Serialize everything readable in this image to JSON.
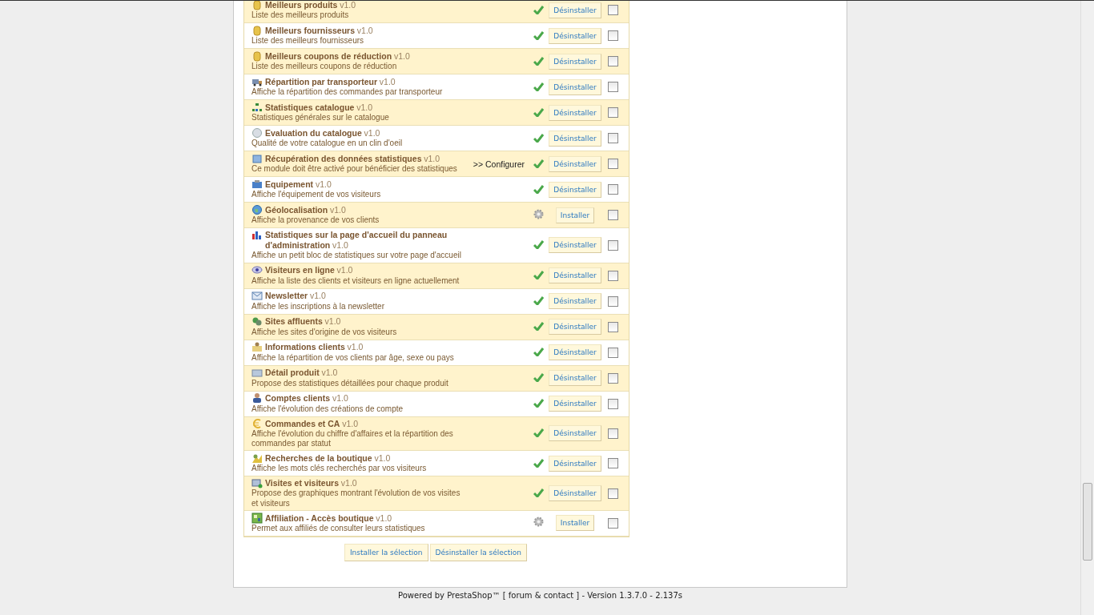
{
  "modules": [
    {
      "name": "Meilleurs produits",
      "version": "v1.0",
      "description": "Liste des meilleurs produits",
      "installed": true,
      "action": "Désinstaller",
      "checked": false
    },
    {
      "name": "Meilleurs fournisseurs",
      "version": "v1.0",
      "description": "Liste des meilleurs fournisseurs",
      "installed": true,
      "action": "Désinstaller",
      "checked": false
    },
    {
      "name": "Meilleurs coupons de réduction",
      "version": "v1.0",
      "description": "Liste des meilleurs coupons de réduction",
      "installed": true,
      "action": "Désinstaller",
      "checked": false
    },
    {
      "name": "Répartition par transporteur",
      "version": "v1.0",
      "description": "Affiche la répartition des commandes par transporteur",
      "installed": true,
      "action": "Désinstaller",
      "checked": false
    },
    {
      "name": "Statistiques catalogue",
      "version": "v1.0",
      "description": "Statistiques générales sur le catalogue",
      "installed": true,
      "action": "Désinstaller",
      "checked": false
    },
    {
      "name": "Evaluation du catalogue",
      "version": "v1.0",
      "description": "Qualité de votre catalogue en un clin d'oeil",
      "installed": true,
      "action": "Désinstaller",
      "checked": false
    },
    {
      "name": "Récupération des données statistiques",
      "version": "v1.0",
      "description": "Ce module doit être activé pour bénéficier des statistiques",
      "configure": ">> Configurer",
      "installed": true,
      "action": "Désinstaller",
      "checked": false
    },
    {
      "name": "Equipement",
      "version": "v1.0",
      "description": "Affiche l'équipement de vos visiteurs",
      "installed": true,
      "action": "Désinstaller",
      "checked": false
    },
    {
      "name": "Géolocalisation",
      "version": "v1.0",
      "description": "Affiche la provenance de vos clients",
      "installed": false,
      "action": "Installer",
      "checked": false
    },
    {
      "name": "Statistiques sur la page d'accueil du panneau d'administration",
      "version": "v1.0",
      "description": "Affiche un petit bloc de statistiques sur votre page d'accueil",
      "installed": true,
      "action": "Désinstaller",
      "checked": false
    },
    {
      "name": "Visiteurs en ligne",
      "version": "v1.0",
      "description": "Affiche la liste des clients et visiteurs en ligne actuellement",
      "installed": true,
      "action": "Désinstaller",
      "checked": false
    },
    {
      "name": "Newsletter",
      "version": "v1.0",
      "description": "Affiche les inscriptions à la newsletter",
      "installed": true,
      "action": "Désinstaller",
      "checked": false
    },
    {
      "name": "Sites affluents",
      "version": "v1.0",
      "description": "Affiche les sites d'origine de vos visiteurs",
      "installed": true,
      "action": "Désinstaller",
      "checked": false
    },
    {
      "name": "Informations clients",
      "version": "v1.0",
      "description": "Affiche la répartition de vos clients par âge, sexe ou pays",
      "installed": true,
      "action": "Désinstaller",
      "checked": false
    },
    {
      "name": "Détail produit",
      "version": "v1.0",
      "description": "Propose des statistiques détaillées pour chaque produit",
      "installed": true,
      "action": "Désinstaller",
      "checked": false
    },
    {
      "name": "Comptes clients",
      "version": "v1.0",
      "description": "Affiche l'évolution des créations de compte",
      "installed": true,
      "action": "Désinstaller",
      "checked": false
    },
    {
      "name": "Commandes et CA",
      "version": "v1.0",
      "description": "Affiche l'évolution du chiffre d'affaires et la répartition des commandes par statut",
      "installed": true,
      "action": "Désinstaller",
      "checked": false
    },
    {
      "name": "Recherches de la boutique",
      "version": "v1.0",
      "description": "Affiche les mots clés recherchés par vos visiteurs",
      "installed": true,
      "action": "Désinstaller",
      "checked": false
    },
    {
      "name": "Visites et visiteurs",
      "version": "v1.0",
      "description": "Propose des graphiques montrant l'évolution de vos visites et visiteurs",
      "installed": true,
      "action": "Désinstaller",
      "checked": false
    },
    {
      "name": "Affiliation - Accès boutique",
      "version": "v1.0",
      "description": "Permet aux affiliés de consulter leurs statistiques",
      "installed": false,
      "action": "Installer",
      "checked": false
    }
  ],
  "bulk_buttons": [
    "Installer la sélection",
    "Désinstaller la sélection"
  ],
  "footer": {
    "before": "Powered by PrestaShop™",
    "link": "[ forum & contact ]",
    "after": "- Version 1.3.7.0 - 2.137s"
  }
}
